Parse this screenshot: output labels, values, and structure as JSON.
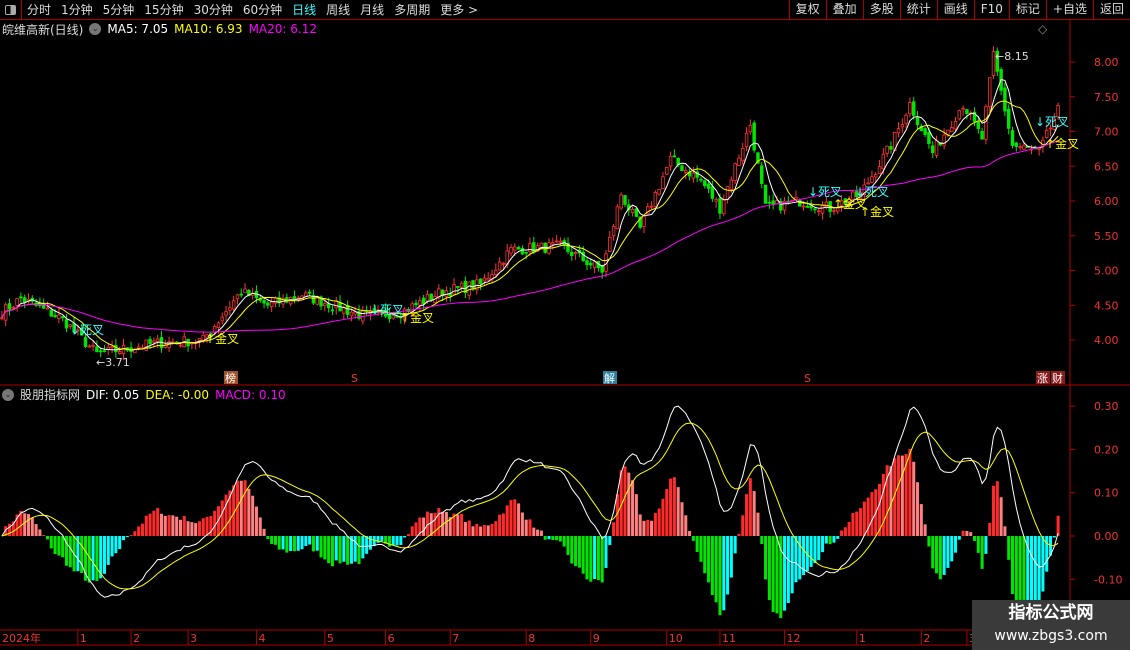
{
  "toolbar": {
    "periods": [
      "分时",
      "1分钟",
      "5分钟",
      "15分钟",
      "30分钟",
      "60分钟",
      "日线",
      "周线",
      "月线",
      "多周期",
      "更多 >"
    ],
    "active": "日线",
    "right_buttons": [
      "复权",
      "叠加",
      "多股",
      "统计",
      "画线",
      "F10",
      "标记",
      "+自选",
      "返回"
    ]
  },
  "main_info": {
    "title": "皖维高新(日线)",
    "ma5": "MA5: 7.05",
    "ma10": "MA10: 6.93",
    "ma20": "MA20: 6.12"
  },
  "sub_info": {
    "title": "股朋指标网",
    "dif": "DIF: 0.05",
    "dea": "DEA: -0.00",
    "macd": "MACD: 0.10"
  },
  "colors": {
    "up": "#ff3232",
    "down": "#00e600",
    "ma5": "#ffffff",
    "ma10": "#ffff00",
    "ma20": "#ff00ff",
    "axis": "#b00000"
  },
  "price_axis": [
    "8.00",
    "7.50",
    "7.00",
    "6.50",
    "6.00",
    "5.50",
    "5.00",
    "4.50",
    "4.00"
  ],
  "macd_axis": [
    "0.30",
    "0.20",
    "0.10",
    "0.00",
    "-0.10"
  ],
  "annotations": {
    "low": "3.71",
    "high": "8.15",
    "dead_cross": "↓死叉",
    "gold_cross": "↑金叉"
  },
  "event_markers": [
    "榜",
    "S",
    "解",
    "S",
    "涨",
    "财"
  ],
  "time_axis": {
    "year": "2024年",
    "months": [
      {
        "label": "1",
        "bar": 20
      },
      {
        "label": "2",
        "bar": 34
      },
      {
        "label": "3",
        "bar": 49
      },
      {
        "label": "4",
        "bar": 67
      },
      {
        "label": "5",
        "bar": 85
      },
      {
        "label": "6",
        "bar": 101
      },
      {
        "label": "7",
        "bar": 118
      },
      {
        "label": "8",
        "bar": 138
      },
      {
        "label": "9",
        "bar": 155
      },
      {
        "label": "10",
        "bar": 175
      },
      {
        "label": "11",
        "bar": 189
      },
      {
        "label": "12",
        "bar": 206
      },
      {
        "label": "1",
        "bar": 225
      },
      {
        "label": "2",
        "bar": 242
      },
      {
        "label": "3",
        "bar": 254
      }
    ]
  },
  "watermark": {
    "line1": "指标公式网",
    "line2": "www.zbgs3.com"
  },
  "chart_data": {
    "type": "candlestick",
    "bars": 279,
    "close_anchors": [
      [
        0,
        4.4
      ],
      [
        5,
        4.6
      ],
      [
        16,
        4.3
      ],
      [
        25,
        3.8
      ],
      [
        40,
        3.95
      ],
      [
        53,
        4.0
      ],
      [
        63,
        4.7
      ],
      [
        70,
        4.5
      ],
      [
        79,
        4.65
      ],
      [
        95,
        4.35
      ],
      [
        105,
        4.4
      ],
      [
        116,
        4.7
      ],
      [
        126,
        4.8
      ],
      [
        134,
        5.3
      ],
      [
        147,
        5.35
      ],
      [
        158,
        5.0
      ],
      [
        163,
        6.1
      ],
      [
        168,
        5.6
      ],
      [
        176,
        6.6
      ],
      [
        184,
        6.3
      ],
      [
        189,
        5.9
      ],
      [
        197,
        7.1
      ],
      [
        201,
        5.9
      ],
      [
        210,
        6.0
      ],
      [
        218,
        5.9
      ],
      [
        226,
        6.1
      ],
      [
        234,
        6.8
      ],
      [
        239,
        7.4
      ],
      [
        245,
        6.7
      ],
      [
        253,
        7.4
      ],
      [
        258,
        6.9
      ],
      [
        261,
        8.1
      ],
      [
        266,
        6.8
      ],
      [
        273,
        6.7
      ],
      [
        278,
        7.3
      ]
    ],
    "price_range": [
      3.6,
      8.4
    ],
    "macd_range": [
      -0.16,
      0.33
    ]
  }
}
